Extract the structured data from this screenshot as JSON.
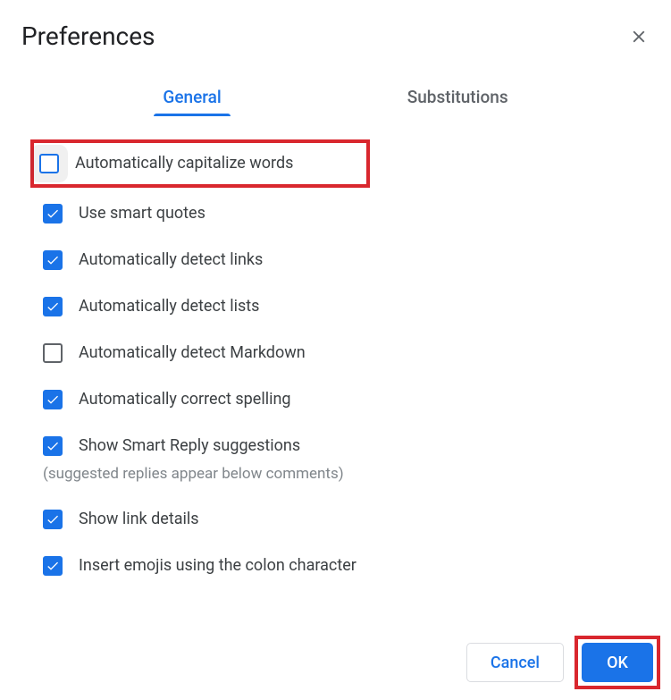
{
  "dialog": {
    "title": "Preferences",
    "tabs": {
      "general": "General",
      "substitutions": "Substitutions"
    },
    "options": [
      {
        "label": "Automatically capitalize words",
        "checked": false,
        "highlighted": true
      },
      {
        "label": "Use smart quotes",
        "checked": true
      },
      {
        "label": "Automatically detect links",
        "checked": true
      },
      {
        "label": "Automatically detect lists",
        "checked": true
      },
      {
        "label": "Automatically detect Markdown",
        "checked": false
      },
      {
        "label": "Automatically correct spelling",
        "checked": true
      },
      {
        "label": "Show Smart Reply suggestions",
        "checked": true,
        "sublabel": "(suggested replies appear below comments)"
      },
      {
        "label": "Show link details",
        "checked": true
      },
      {
        "label": "Insert emojis using the colon character",
        "checked": true
      }
    ],
    "buttons": {
      "cancel": "Cancel",
      "ok": "OK"
    }
  }
}
